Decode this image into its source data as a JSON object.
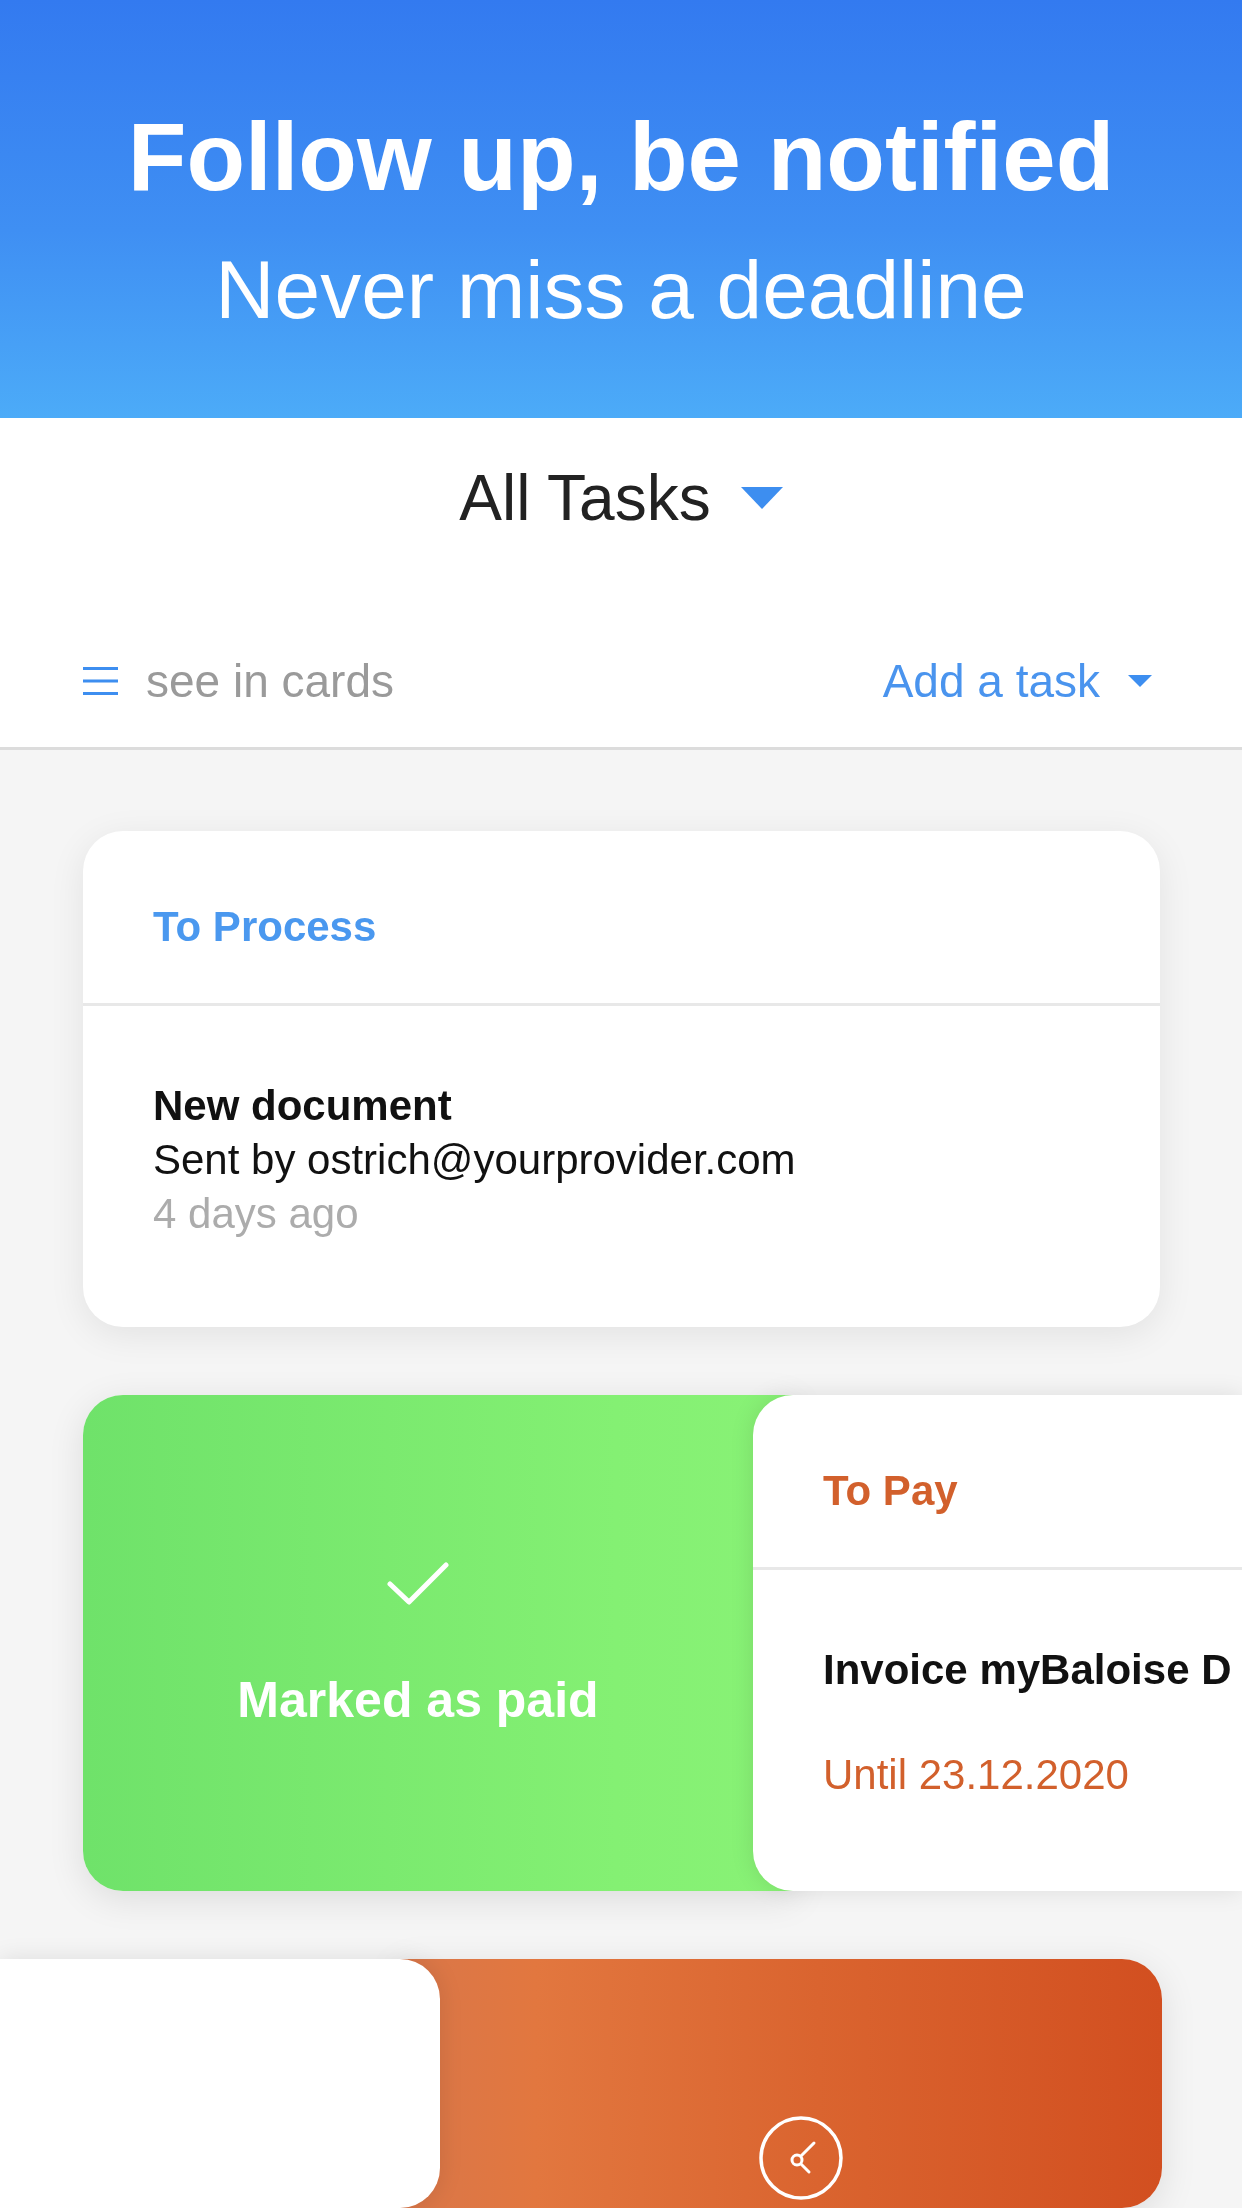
{
  "banner": {
    "title": "Follow up, be notified",
    "subtitle": "Never miss a deadline"
  },
  "filter": {
    "label": "All Tasks"
  },
  "toolbar": {
    "view_toggle": "see in cards",
    "add_button": "Add a task"
  },
  "tasks": [
    {
      "kind": "resting",
      "category": "To Process",
      "color": "#4a98ef",
      "title": "New document",
      "detail": "Sent by ostrich@yourprovider.com",
      "time": "4 days ago"
    },
    {
      "kind": "swiped_right",
      "category": "To Pay",
      "color": "#d2602c",
      "title": "Invoice myBaloise D",
      "due": "Until 23.12.2020",
      "action": {
        "kind": "check",
        "label": "Marked as paid"
      }
    },
    {
      "kind": "swiped_left",
      "action": {
        "kind": "clock"
      }
    }
  ]
}
